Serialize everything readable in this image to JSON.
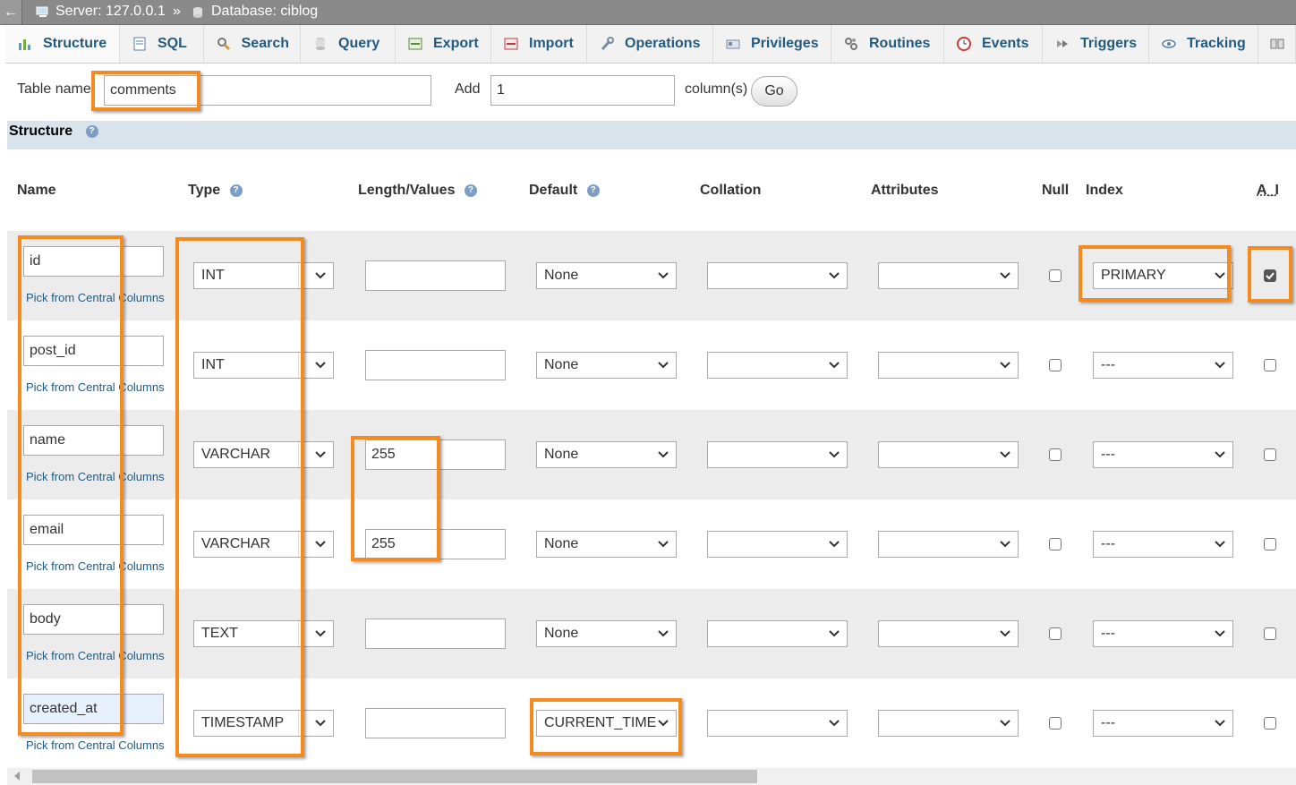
{
  "breadcrumb": {
    "back": "←",
    "server": "Server: 127.0.0.1",
    "separator": "»",
    "database": "Database: ciblog"
  },
  "tabs": [
    "Structure",
    "SQL",
    "Search",
    "Query",
    "Export",
    "Import",
    "Operations",
    "Privileges",
    "Routines",
    "Events",
    "Triggers",
    "Tracking"
  ],
  "table_name": {
    "label": "Table name:",
    "value": "comments"
  },
  "add_columns": {
    "label": "Add",
    "value": "1",
    "suffix": "column(s)",
    "go": "Go"
  },
  "structure": {
    "heading": "Structure"
  },
  "headers": {
    "name": "Name",
    "type": "Type",
    "length": "Length/Values",
    "default": "Default",
    "collation": "Collation",
    "attributes": "Attributes",
    "null": "Null",
    "index": "Index",
    "ai": "A_I"
  },
  "pick_label": "Pick from Central Columns",
  "rows": [
    {
      "name": "id",
      "type": "INT",
      "length": "",
      "default": "None",
      "index": "PRIMARY",
      "ai": true
    },
    {
      "name": "post_id",
      "type": "INT",
      "length": "",
      "default": "None",
      "index": "---",
      "ai": false
    },
    {
      "name": "name",
      "type": "VARCHAR",
      "length": "255",
      "default": "None",
      "index": "---",
      "ai": false
    },
    {
      "name": "email",
      "type": "VARCHAR",
      "length": "255",
      "default": "None",
      "index": "---",
      "ai": false
    },
    {
      "name": "body",
      "type": "TEXT",
      "length": "",
      "default": "None",
      "index": "---",
      "ai": false
    },
    {
      "name": "created_at",
      "type": "TIMESTAMP",
      "length": "",
      "default": "CURRENT_TIME",
      "index": "---",
      "ai": false
    }
  ],
  "colors": {
    "link": "#235a81",
    "highlight": "#f58a1f",
    "header_bg": "#d9e3ec",
    "row_shade": "#ececec"
  }
}
